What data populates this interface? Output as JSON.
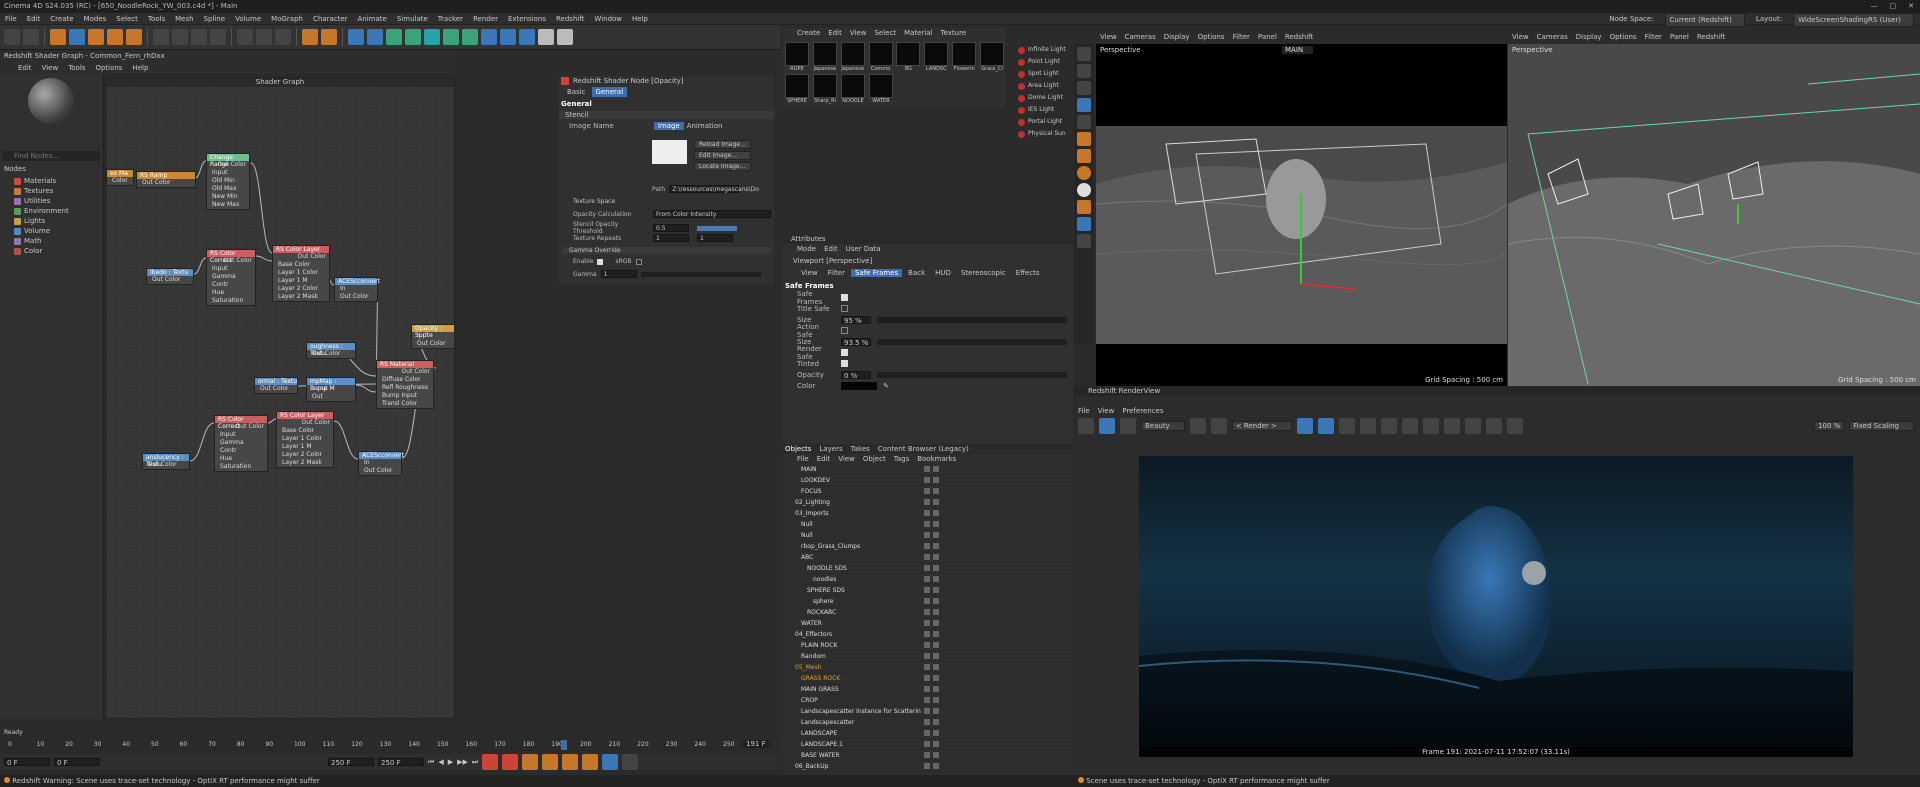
{
  "window": {
    "title": "Cinema 4D S24.035 (RC) - [650_NoodleRock_YW_003.c4d *] - Main"
  },
  "menu": [
    "File",
    "Edit",
    "Create",
    "Modes",
    "Select",
    "Tools",
    "Mesh",
    "Spline",
    "Volume",
    "MoGraph",
    "Character",
    "Animate",
    "Simulate",
    "Tracker",
    "Render",
    "Extensions",
    "Redshift",
    "Window",
    "Help"
  ],
  "menu_right": {
    "node_space_label": "Node Space:",
    "node_space": "Current (Redshift)",
    "layout_label": "Layout:",
    "layout": "WideScreenShadingRS (User)"
  },
  "shader_graph": {
    "header": "Redshift Shader Graph - Common_Fern_rhDxx",
    "menu": [
      "Edit",
      "View",
      "Tools",
      "Options",
      "Help"
    ],
    "search_placeholder": "Find Nodes...",
    "nodes_label": "Nodes",
    "categories": [
      "Materials",
      "Textures",
      "Utilities",
      "Environment",
      "Lights",
      "Volume",
      "Math",
      "Color"
    ],
    "category_colors": [
      "#c94848",
      "#c87a3a",
      "#9b6fb5",
      "#5a9a5a",
      "#c9a040",
      "#4a8fc0",
      "#8a7ab0",
      "#b05050"
    ],
    "title": "Shader Graph",
    "nodes": [
      {
        "title": "RS Ramp",
        "ports": [
          "Out Color"
        ],
        "color": "#c58a3a"
      },
      {
        "title": "Change Range",
        "ports": [
          "Input",
          "Old Min",
          "Old Max",
          "New Min",
          "New Max"
        ],
        "out": "Out Color",
        "color": "#6fbf8a"
      },
      {
        "title": "RS Color Correct",
        "ports": [
          "Input",
          "Gamma",
          "Contr",
          "Hue",
          "Saturation"
        ],
        "out": "Out Color",
        "color": "#c96060"
      },
      {
        "title": "RS Color Layer",
        "ports": [
          "Base Color",
          "Layer 1 Color",
          "Layer 1 M",
          "Layer 2 Color",
          "Layer 2 Mask"
        ],
        "out": "Out Color",
        "color": "#c96060"
      },
      {
        "title": "lbedo : Textu",
        "ports": [
          "Out Color"
        ],
        "color": "#5a8fc0"
      },
      {
        "title": "ACEScconvert",
        "ports": [
          "In",
          "Out Color"
        ],
        "color": "#5a8fc0"
      },
      {
        "title": "Opacity : Sprite",
        "ports": [
          "Inp",
          "Out Color"
        ],
        "color": "#d0a040"
      },
      {
        "title": "oughness : Textu",
        "ports": [
          "Out Color"
        ],
        "color": "#5a8fc0"
      },
      {
        "title": "RS Material",
        "ports": [
          "Diffuse Color",
          "Refl Roughness",
          "Bump Input",
          "Transl Color"
        ],
        "out": "Out Color",
        "color": "#c96060"
      },
      {
        "title": "ormal : Textu",
        "ports": [
          "Out Color"
        ],
        "color": "#5a8fc0"
      },
      {
        "title": "mpMap : Bump M",
        "ports": [
          "Input",
          "Out"
        ],
        "color": "#5a8fc0"
      },
      {
        "title": "RS Color Correct",
        "ports": [
          "Input",
          "Gamma",
          "Contr",
          "Hue",
          "Saturation"
        ],
        "out": "Out Color",
        "color": "#c96060"
      },
      {
        "title": "RS Color Layer",
        "ports": [
          "Base Color",
          "Layer 1 Color",
          "Layer 1 M",
          "Layer 2 Color",
          "Layer 2 Mask"
        ],
        "out": "Out Color",
        "color": "#c96060"
      },
      {
        "title": "anslucency : Textu",
        "ports": [
          "Out Color"
        ],
        "color": "#5a8fc0"
      },
      {
        "title": "ACEScconvert",
        "ports": [
          "In",
          "Out Color"
        ],
        "color": "#5a8fc0"
      },
      {
        "title": "ex Ma",
        "ports": [
          "Color"
        ],
        "color": "#c58a3a"
      }
    ]
  },
  "shader_node": {
    "header": "Redshift Shader Node [Opacity]",
    "tabs": [
      "Basic",
      "General"
    ],
    "section": "General",
    "sub": "Stencil",
    "image_name_label": "Image Name",
    "img_tabs": [
      "Image",
      "Animation"
    ],
    "buttons": [
      "Reload Image...",
      "Edit Image...",
      "Locate Image..."
    ],
    "path_label": "Path",
    "path_value": "Z:\\ressources\\megascans\\Do",
    "texture_space": "Texture Space",
    "opacity_calc_label": "Opacity Calculation",
    "opacity_calc_value": "From Color Intensity",
    "stencil_thresh_label": "Stencil Opacity Threshold",
    "stencil_thresh_value": "0.5",
    "tex_repeats_label": "Texture Repeats",
    "tex_repeats_u": "1",
    "tex_repeats_v": "1",
    "gamma_override": "Gamma Override",
    "enable_label": "Enable",
    "srgb_label": "sRGB",
    "gamma_label": "Gamma",
    "gamma_value": "1"
  },
  "materials": {
    "menu": [
      "Create",
      "Edit",
      "View",
      "Select",
      "Material",
      "Texture"
    ],
    "row1": [
      "ROPE",
      "Japanese",
      "Japanese",
      "Commo",
      "BG",
      "LANDSC",
      "Flowerin",
      "Grass_Cl"
    ],
    "row2": [
      "SPHERE",
      "Sharp_Ri",
      "NOODLE",
      "WATER"
    ]
  },
  "lights": [
    "Infinite Light",
    "Point Light",
    "Spot Light",
    "Area Light",
    "Dome Light",
    "IES Light",
    "Portal Light",
    "Physical Sun"
  ],
  "attributes": {
    "header": "Attributes",
    "menu": [
      "Mode",
      "Edit",
      "User Data"
    ],
    "viewport_label": "Viewport [Perspective]",
    "tabs": [
      "View",
      "Filter",
      "Safe Frames",
      "Back",
      "HUD",
      "Stereoscopic",
      "Effects"
    ],
    "section": "Safe Frames",
    "rows": [
      {
        "label": "Safe Frames",
        "checked": true
      },
      {
        "label": "Title Safe",
        "checked": false
      },
      {
        "label": "Size",
        "value": "95 %"
      },
      {
        "label": "Action Safe",
        "checked": false
      },
      {
        "label": "Size",
        "value": "93.5 %"
      },
      {
        "label": "Render Safe",
        "checked": true
      },
      {
        "label": "Tinted",
        "checked": true
      },
      {
        "label": "Opacity",
        "value": "0 %"
      },
      {
        "label": "Color"
      }
    ]
  },
  "objects": {
    "tabs": [
      "Objects",
      "Layers",
      "Takes",
      "Content Browser (Legacy)"
    ],
    "menu": [
      "File",
      "Edit",
      "View",
      "Object",
      "Tags",
      "Bookmarks"
    ],
    "items": [
      {
        "name": "MAIN",
        "indent": 1,
        "color": "#ddd"
      },
      {
        "name": "LOOKDEV",
        "indent": 1,
        "color": "#ddd"
      },
      {
        "name": "FOCUS",
        "indent": 1,
        "color": "#ddd"
      },
      {
        "name": "02_Lighting",
        "indent": 0,
        "color": "#ddd"
      },
      {
        "name": "03_Imports",
        "indent": 0,
        "color": "#ddd"
      },
      {
        "name": "Null",
        "indent": 1,
        "color": "#ddd"
      },
      {
        "name": "Null",
        "indent": 1,
        "color": "#ddd"
      },
      {
        "name": "rbop_Grass_Clumps",
        "indent": 1,
        "color": "#ddd"
      },
      {
        "name": "ABC",
        "indent": 1,
        "color": "#ddd"
      },
      {
        "name": "NOODLE SDS",
        "indent": 2,
        "color": "#ddd"
      },
      {
        "name": "noodles",
        "indent": 3,
        "color": "#ddd"
      },
      {
        "name": "SPHERE SDS",
        "indent": 2,
        "color": "#ddd"
      },
      {
        "name": "sphere",
        "indent": 3,
        "color": "#ddd"
      },
      {
        "name": "ROCKABC",
        "indent": 2,
        "color": "#ddd"
      },
      {
        "name": "WATER",
        "indent": 1,
        "color": "#ddd"
      },
      {
        "name": "04_Effectors",
        "indent": 0,
        "color": "#ddd"
      },
      {
        "name": "PLAIN ROCK",
        "indent": 1,
        "color": "#ddd"
      },
      {
        "name": "Random",
        "indent": 1,
        "color": "#ddd"
      },
      {
        "name": "05_Mesh",
        "indent": 0,
        "color": "#e0a030"
      },
      {
        "name": "GRASS ROCK",
        "indent": 1,
        "color": "#e0a030"
      },
      {
        "name": "MAIN GRASS",
        "indent": 1,
        "color": "#ddd"
      },
      {
        "name": "CROP",
        "indent": 1,
        "color": "#ddd"
      },
      {
        "name": "Landscapescatter Instance for Scattering",
        "indent": 1,
        "color": "#ddd"
      },
      {
        "name": "Landscapescatter",
        "indent": 1,
        "color": "#ddd"
      },
      {
        "name": "LANDSCAPE",
        "indent": 1,
        "color": "#ddd"
      },
      {
        "name": "LANDSCAPE.1",
        "indent": 1,
        "color": "#ddd"
      },
      {
        "name": "BASE WATER",
        "indent": 1,
        "color": "#ddd"
      },
      {
        "name": "06_BackUp",
        "indent": 0,
        "color": "#ddd"
      }
    ]
  },
  "viewport_left": {
    "menu": [
      "View",
      "Cameras",
      "Display",
      "Options",
      "Filter",
      "Panel",
      "Redshift"
    ],
    "name": "Perspective",
    "camera": "MAIN",
    "grid": "Grid Spacing : 500 cm"
  },
  "viewport_right": {
    "menu": [
      "View",
      "Cameras",
      "Display",
      "Options",
      "Filter",
      "Panel",
      "Redshift"
    ],
    "name": "Perspective",
    "grid": "Grid Spacing : 500 cm"
  },
  "render_view": {
    "header": "Redshift RenderView",
    "menu": [
      "File",
      "View",
      "Preferences"
    ],
    "aov": "Beauty",
    "camera": "< Render >",
    "zoom": "100 %",
    "scaling": "Fixed Scaling",
    "frame_info": "Frame  191:  2021-07-11  17:52:07  (33.11s)"
  },
  "timeline": {
    "ready": "Ready",
    "ticks": [
      "0",
      "10",
      "20",
      "30",
      "40",
      "50",
      "60",
      "70",
      "80",
      "90",
      "100",
      "110",
      "120",
      "130",
      "140",
      "150",
      "160",
      "170",
      "180",
      "190",
      "200",
      "210",
      "220",
      "230",
      "240",
      "250"
    ],
    "current": "191 F",
    "start": "0 F",
    "start2": "0 F",
    "end": "250 F",
    "end2": "250 F"
  },
  "status": {
    "left": "Redshift Warning: Scene uses trace-set technology - OptiX RT performance might suffer",
    "right": "Scene uses trace-set technology - OptiX RT performance might suffer"
  }
}
